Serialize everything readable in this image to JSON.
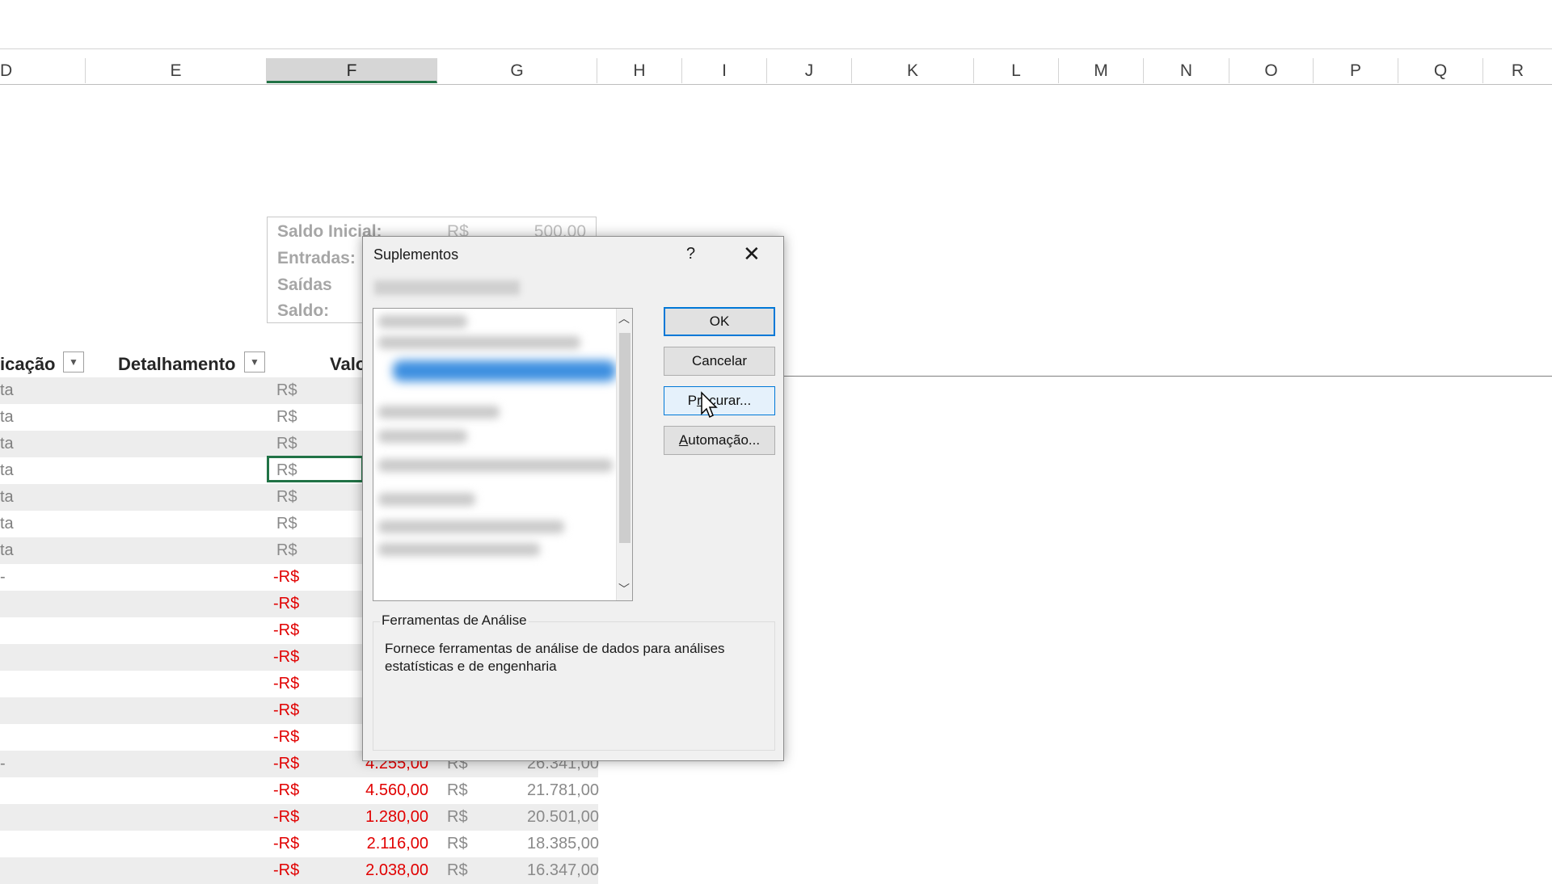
{
  "columns": [
    "D",
    "E",
    "F",
    "G",
    "H",
    "I",
    "J",
    "K",
    "L",
    "M",
    "N",
    "O",
    "P",
    "Q",
    "R"
  ],
  "selected_column": "F",
  "summary": {
    "rows": [
      {
        "label": "Saldo Inicial:",
        "currency": "R$",
        "value": "500,00"
      },
      {
        "label": "Entradas:",
        "currency": "",
        "value": ""
      },
      {
        "label": "Saídas",
        "currency": "",
        "value": ""
      },
      {
        "label": "Saldo:",
        "currency": "",
        "value": ""
      }
    ]
  },
  "table": {
    "headers": {
      "classificacao": "icação",
      "detalhamento": "Detalhamento",
      "valor": "Valo"
    },
    "rows": [
      {
        "a": "ta",
        "cur": "R$",
        "val": "",
        "cur2": "",
        "bal": ""
      },
      {
        "a": "ta",
        "cur": "R$",
        "val": "",
        "cur2": "",
        "bal": ""
      },
      {
        "a": "ta",
        "cur": "R$",
        "val": "",
        "cur2": "",
        "bal": ""
      },
      {
        "a": "ta",
        "cur": "R$",
        "val": "",
        "cur2": "",
        "bal": ""
      },
      {
        "a": "ta",
        "cur": "R$",
        "val": "",
        "cur2": "",
        "bal": ""
      },
      {
        "a": "ta",
        "cur": "R$",
        "val": "",
        "cur2": "",
        "bal": ""
      },
      {
        "a": "ta",
        "cur": "R$",
        "val": "",
        "cur2": "",
        "bal": ""
      },
      {
        "a": "-",
        "cur": "-R$",
        "val": "",
        "cur2": "",
        "bal": ""
      },
      {
        "a": "",
        "cur": "-R$",
        "val": "",
        "cur2": "",
        "bal": ""
      },
      {
        "a": "",
        "cur": "-R$",
        "val": "",
        "cur2": "",
        "bal": ""
      },
      {
        "a": "",
        "cur": "-R$",
        "val": "",
        "cur2": "",
        "bal": ""
      },
      {
        "a": "",
        "cur": "-R$",
        "val": "",
        "cur2": "",
        "bal": ""
      },
      {
        "a": "",
        "cur": "-R$",
        "val": "",
        "cur2": "",
        "bal": ""
      },
      {
        "a": "",
        "cur": "-R$",
        "val": "",
        "cur2": "",
        "bal": ""
      },
      {
        "a": "-",
        "cur": "-R$",
        "val": "4.255,00",
        "cur2": "R$",
        "bal": "26.341,00"
      },
      {
        "a": "",
        "cur": "-R$",
        "val": "4.560,00",
        "cur2": "R$",
        "bal": "21.781,00"
      },
      {
        "a": "",
        "cur": "-R$",
        "val": "1.280,00",
        "cur2": "R$",
        "bal": "20.501,00"
      },
      {
        "a": "",
        "cur": "-R$",
        "val": "2.116,00",
        "cur2": "R$",
        "bal": "18.385,00"
      },
      {
        "a": "",
        "cur": "-R$",
        "val": "2.038,00",
        "cur2": "R$",
        "bal": "16.347,00"
      }
    ]
  },
  "dialog": {
    "title": "Suplementos",
    "help": "?",
    "close": "✕",
    "buttons": {
      "ok": "OK",
      "cancel": "Cancelar",
      "browse_pre": "P",
      "browse_mnemonic": "r",
      "browse_post": "ocurar...",
      "automation_mnemonic": "A",
      "automation_post": "utomação..."
    },
    "description_title": "Ferramentas de Análise",
    "description_text": "Fornece ferramentas de análise de dados para análises estatísticas e de engenharia"
  },
  "colors": {
    "accent": "#217346",
    "negative": "#e10000",
    "focus": "#0078d7"
  }
}
